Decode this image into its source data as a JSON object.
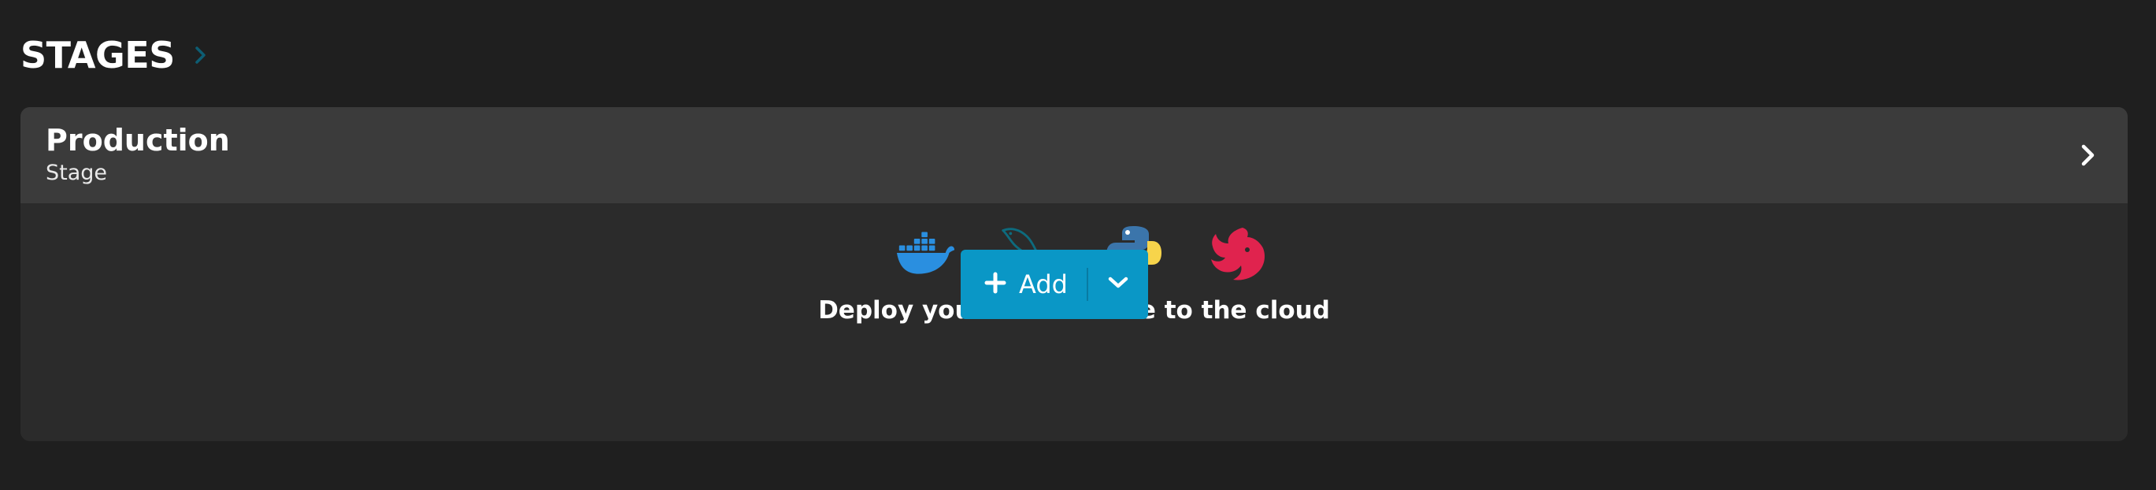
{
  "section": {
    "title": "STAGES",
    "chevron_icon": "chevron-right-icon"
  },
  "stage": {
    "name": "Production",
    "type_label": "Stage",
    "open_icon": "chevron-right-icon"
  },
  "empty_state": {
    "icons": [
      "docker-icon",
      "mysql-icon",
      "python-icon",
      "nestjs-icon"
    ],
    "message": "Deploy your first service to the cloud"
  },
  "add_button": {
    "label": "Add",
    "icon": "plus-icon",
    "dropdown_icon": "chevron-down-icon"
  },
  "colors": {
    "page_background": "#1f1f1f",
    "card_background": "#2b2b2b",
    "card_header_background": "#3b3b3b",
    "accent": "#0a97c6",
    "section_chevron": "#0d5d73",
    "docker": "#2a8fe0",
    "mysql": "#0d6b7e",
    "python_blue": "#3b75ab",
    "python_yellow": "#f7d44b",
    "nestjs": "#e0234e"
  }
}
